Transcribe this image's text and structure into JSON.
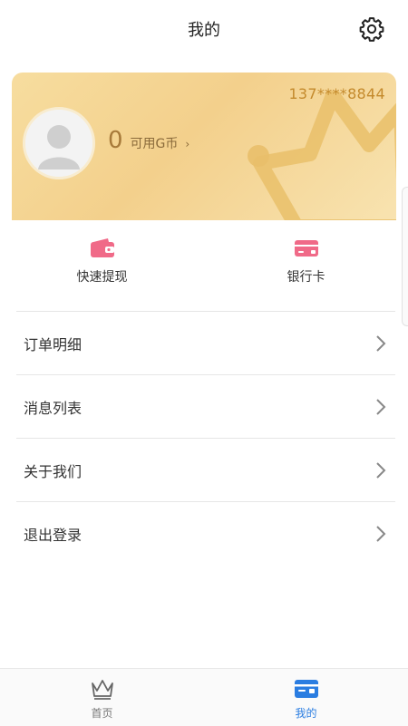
{
  "header": {
    "title": "我的",
    "settings_icon": "gear-icon"
  },
  "profile": {
    "phone": "137****8844",
    "coin_value": "0",
    "coin_label": "可用G币",
    "coin_arrow": "›",
    "avatar_icon": "avatar-placeholder-icon"
  },
  "quick_actions": [
    {
      "label": "快速提现",
      "icon": "wallet-icon",
      "color": "#f06a88"
    },
    {
      "label": "银行卡",
      "icon": "bank-card-icon",
      "color": "#f06a88"
    }
  ],
  "menu": [
    {
      "label": "订单明细"
    },
    {
      "label": "消息列表"
    },
    {
      "label": "关于我们"
    },
    {
      "label": "退出登录"
    }
  ],
  "tabbar": {
    "tabs": [
      {
        "label": "首页",
        "icon": "crown-icon",
        "active": false
      },
      {
        "label": "我的",
        "icon": "profile-card-icon",
        "active": true
      }
    ],
    "active_color": "#2a7de1",
    "inactive_color": "#777777"
  },
  "colors": {
    "card_gold": "#f3d08c",
    "accent_pink": "#f06a88",
    "accent_blue": "#2a7de1"
  }
}
